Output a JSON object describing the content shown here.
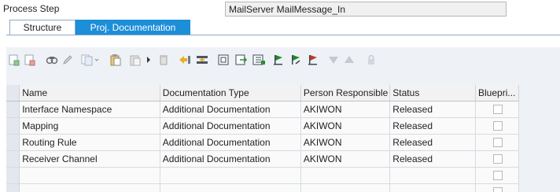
{
  "header": {
    "field_label": "Process Step",
    "field_value": "MailServer MailMessage_In"
  },
  "tabs": [
    {
      "label": "Structure",
      "active": false
    },
    {
      "label": "Proj. Documentation",
      "active": true
    }
  ],
  "toolbar": {
    "buttons": [
      "add-row-icon",
      "delete-row-icon",
      "find-icon",
      "edit-icon",
      "copy-icon",
      "paste-icon",
      "paste-special-icon",
      "more-arrow-icon",
      "trash-icon",
      "insert-icon",
      "split-icon",
      "window-icon",
      "export-icon",
      "list-icon",
      "flag-green-icon",
      "flag-green-edit-icon",
      "flag-red-icon",
      "move-down-icon",
      "move-up-icon",
      "lock-icon"
    ]
  },
  "table": {
    "columns": [
      "Name",
      "Documentation Type",
      "Person Responsible",
      "Status",
      "Bluepri..."
    ],
    "rows": [
      {
        "name": "Interface Namespace",
        "doc_type": "Additional Documentation",
        "person": "AKIWON",
        "status": "Released"
      },
      {
        "name": "Mapping",
        "doc_type": "Additional Documentation",
        "person": "AKIWON",
        "status": "Released"
      },
      {
        "name": "Routing Rule",
        "doc_type": "Additional Documentation",
        "person": "AKIWON",
        "status": "Released"
      },
      {
        "name": "Receiver Channel",
        "doc_type": "Additional Documentation",
        "person": "AKIWON",
        "status": "Released"
      },
      {
        "name": "",
        "doc_type": "",
        "person": "",
        "status": ""
      },
      {
        "name": "",
        "doc_type": "",
        "person": "",
        "status": ""
      }
    ]
  },
  "colors": {
    "tab_active": "#1d8ed8",
    "panel_bg": "#eef1f6"
  }
}
